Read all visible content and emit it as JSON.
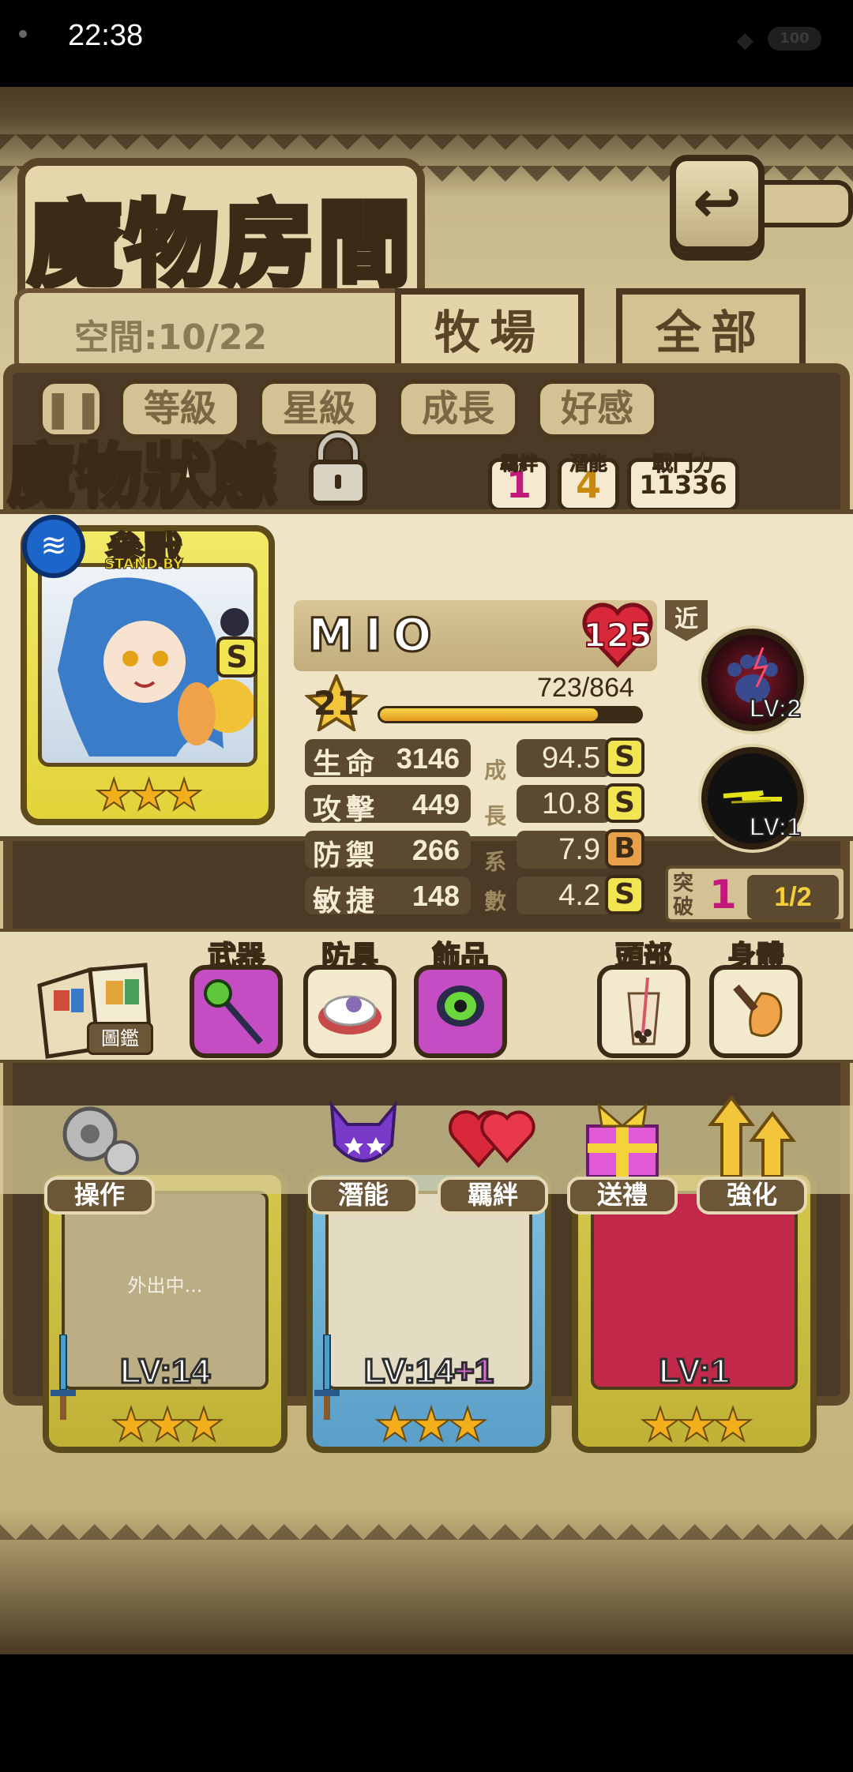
{
  "status_bar": {
    "time": "22:38",
    "battery": "100"
  },
  "header": {
    "title": "魔物房間",
    "back_icon": "return-arrow-icon"
  },
  "room": {
    "space_text": "空間:10/22"
  },
  "tabs": [
    {
      "label": "牧場",
      "active": true
    },
    {
      "label": "全部",
      "active": false
    }
  ],
  "sort": {
    "toggle_icon": "pause-icon",
    "buttons": [
      "等級",
      "星級",
      "成長",
      "好感"
    ]
  },
  "panel": {
    "title": "魔物狀態",
    "lock_icon": "padlock-icon",
    "bond": {
      "label": "羈絆",
      "value": "1"
    },
    "potential": {
      "label": "潛能",
      "value": "4"
    },
    "power": {
      "label": "戰鬥力",
      "value": "11336"
    }
  },
  "monster": {
    "name": "MIO",
    "affection": "125",
    "status": "參戰",
    "status_sub": "STAND BY",
    "rank": "S",
    "element_icon": "water-element-icon",
    "stars": 3,
    "level": "21",
    "exp_text": "723/864",
    "exp_fraction": 0.837,
    "stats": [
      {
        "label": "生命",
        "value": "3146",
        "growth_label": "成",
        "growth": "94.5",
        "grade": "S"
      },
      {
        "label": "攻擊",
        "value": "449",
        "growth_label": "長",
        "growth": "10.8",
        "grade": "S"
      },
      {
        "label": "防禦",
        "value": "266",
        "growth_label": "系",
        "growth": "7.9",
        "grade": "B"
      },
      {
        "label": "敏捷",
        "value": "148",
        "growth_label": "數",
        "growth": "4.2",
        "grade": "S"
      }
    ],
    "range": "近",
    "skills": [
      {
        "icon": "paw-skill-icon",
        "level": "LV:2"
      },
      {
        "icon": "lightning-skill-icon",
        "level": "LV:1"
      }
    ],
    "breakthrough": {
      "label": "突破",
      "value": "1",
      "progress": "1/2"
    }
  },
  "equipment": {
    "encyclopedia_label": "圖鑑",
    "slots": [
      {
        "label": "武器",
        "icon": "paw-staff-icon"
      },
      {
        "label": "防具",
        "icon": "eye-hat-icon"
      },
      {
        "label": "飾品",
        "icon": "eye-amulet-icon"
      },
      {
        "label": "頭部",
        "icon": "bubble-tea-icon"
      },
      {
        "label": "身體",
        "icon": "chicken-leg-icon"
      }
    ]
  },
  "roster": [
    {
      "level": "LV:14",
      "plus": "",
      "stars": 3,
      "note": "外出中..."
    },
    {
      "level": "LV:14",
      "plus": "+1",
      "stars": 3,
      "note": ""
    },
    {
      "level": "LV:1",
      "plus": "",
      "stars": 3,
      "note": ""
    }
  ],
  "actions": [
    {
      "label": "操作",
      "icon": "gears-icon"
    },
    {
      "label": "潛能",
      "icon": "demon-potential-icon"
    },
    {
      "label": "羈絆",
      "icon": "hearts-icon"
    },
    {
      "label": "送禮",
      "icon": "gift-icon"
    },
    {
      "label": "強化",
      "icon": "upgrade-arrows-icon"
    }
  ],
  "colors": {
    "accent": "#5f4a2c",
    "paper": "#efe4c5",
    "grade_s": "#f1e552",
    "grade_b": "#e8a04a",
    "bond_pink": "#c2197a"
  }
}
